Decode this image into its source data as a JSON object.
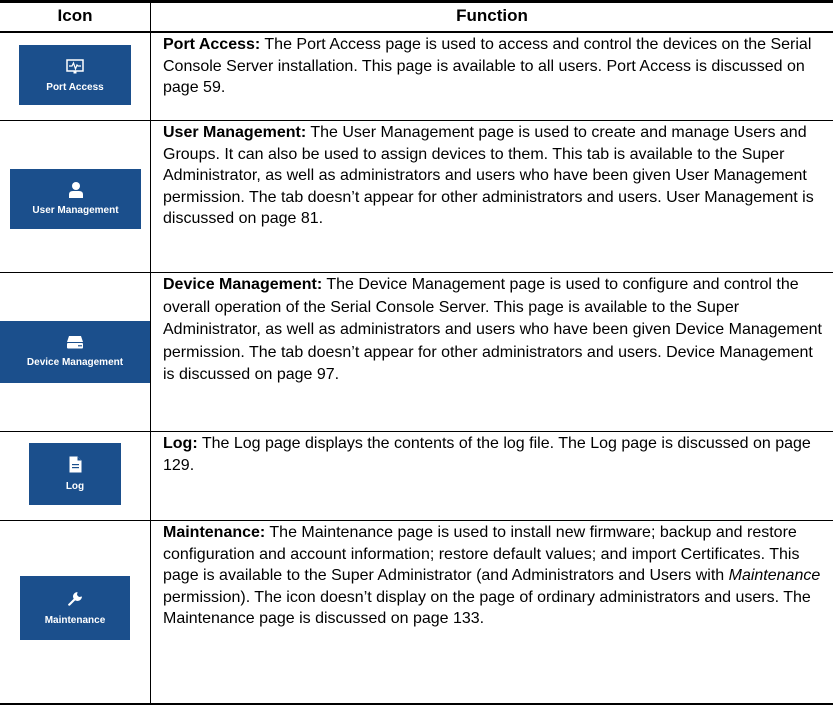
{
  "table": {
    "headers": {
      "icon": "Icon",
      "function": "Function"
    },
    "rows": [
      {
        "icon_name": "monitor-pulse-icon",
        "tile_label": "Port Access",
        "title": "Port Access:",
        "desc": "The Port Access page is used to access and control the devices on the Serial Console Server installation. This page is available to all users. Port Access is discussed on page 59."
      },
      {
        "icon_name": "user-icon",
        "tile_label": "User Management",
        "title": "User Management:",
        "desc": "The User Management page is used to create and manage Users and Groups. It can also be used to assign devices to them. This tab is available to the Super Administrator, as well as administrators and users who have been given User Management permission. The tab doesn’t appear for other administrators and users. User Management is discussed on page 81."
      },
      {
        "icon_name": "server-drive-icon",
        "tile_label": "Device Management",
        "title": "Device Management:",
        "desc": "The Device Management page is used to configure and control the overall operation of the Serial Console Server. This page is available to the Super Administrator, as well as administrators and users who have been given Device Management permission. The tab doesn’t appear for other administrators and users. Device Management is discussed on page 97."
      },
      {
        "icon_name": "document-icon",
        "tile_label": "Log",
        "title": "Log:",
        "desc": "The Log page displays the contents of the log file. The Log page is discussed on page 129."
      },
      {
        "icon_name": "wrench-icon",
        "tile_label": "Maintenance",
        "title": "Maintenance:",
        "desc_before": "The Maintenance page is used to install new firmware; backup and restore configuration and account information; restore default values; and import Certificates. This page is available to the Super Administrator (and Administrators and Users with",
        "desc_italic": "Maintenance",
        "desc_after": "permission). The icon doesn’t display on the page of ordinary administrators and users. The Maintenance page is discussed on page 133."
      }
    ]
  },
  "colors": {
    "tile_bg": "#1b4f8c",
    "tile_fg": "#ffffff",
    "rule": "#000000"
  }
}
